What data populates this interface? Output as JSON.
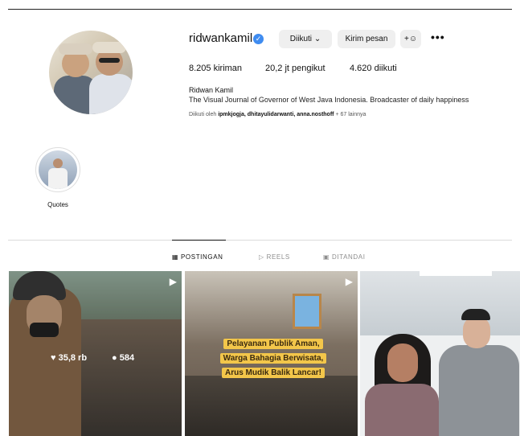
{
  "profile": {
    "username": "ridwankamil",
    "follow_button": "Diikuti",
    "message_button": "Kirim pesan",
    "add_user_glyph": "+",
    "more_glyph": "•••",
    "stats": {
      "posts": "8.205 kiriman",
      "followers": "20,2 jt pengikut",
      "following": "4.620 diikuti"
    },
    "full_name": "Ridwan Kamil",
    "bio": "The Visual Journal of Governor of West Java Indonesia. Broadcaster of daily happiness",
    "followed_by": {
      "prefix": "Diikuti oleh",
      "names": "ipmkjogja, dhitayulidarwanti, anna.nosthoff",
      "suffix": "+ 67 lainnya"
    }
  },
  "highlights": [
    {
      "label": "Quotes"
    }
  ],
  "tabs": [
    {
      "icon": "grid-icon",
      "label": "POSTINGAN",
      "active": true
    },
    {
      "icon": "reels-icon",
      "label": "REELS",
      "active": false
    },
    {
      "icon": "tagged-icon",
      "label": "DITANDAI",
      "active": false
    }
  ],
  "posts": [
    {
      "likes": "35,8 rb",
      "comments": "584"
    },
    {
      "banner": [
        "Pelayanan Publik Aman,",
        "Warga Bahagia Berwisata,",
        "Arus Mudik Balik Lancar!"
      ]
    },
    {}
  ],
  "colors": {
    "verified": "#3f8cf0",
    "button_bg": "#efefef",
    "tab_inactive": "#8e8e8e"
  }
}
